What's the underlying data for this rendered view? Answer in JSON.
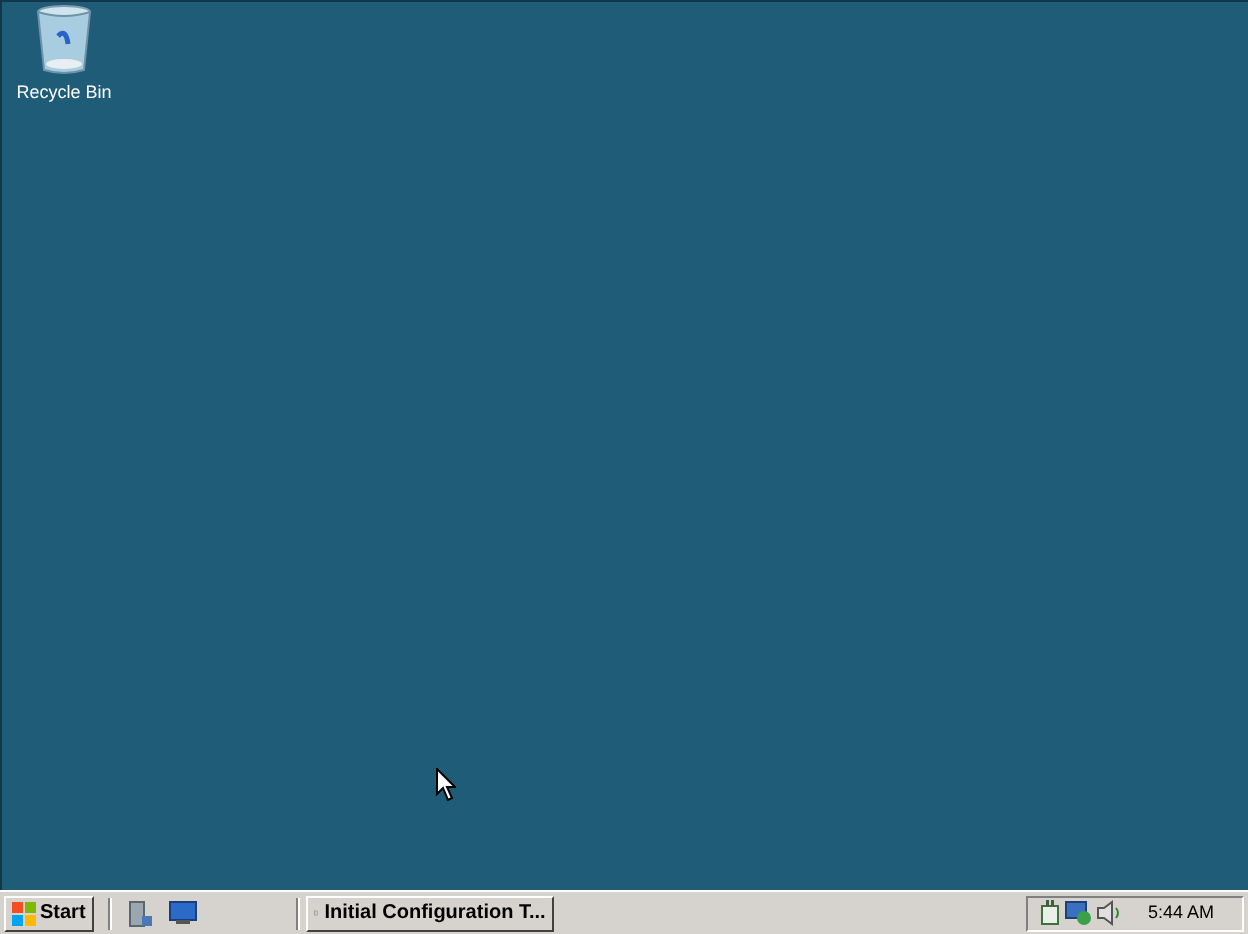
{
  "desktop_icons": [
    {
      "label": "Recycle Bin"
    }
  ],
  "taskbar": {
    "start_label": "Start",
    "window_buttons": [
      {
        "label": "Initial Configuration T...",
        "selected": false
      }
    ],
    "clock": "5:44 AM"
  }
}
